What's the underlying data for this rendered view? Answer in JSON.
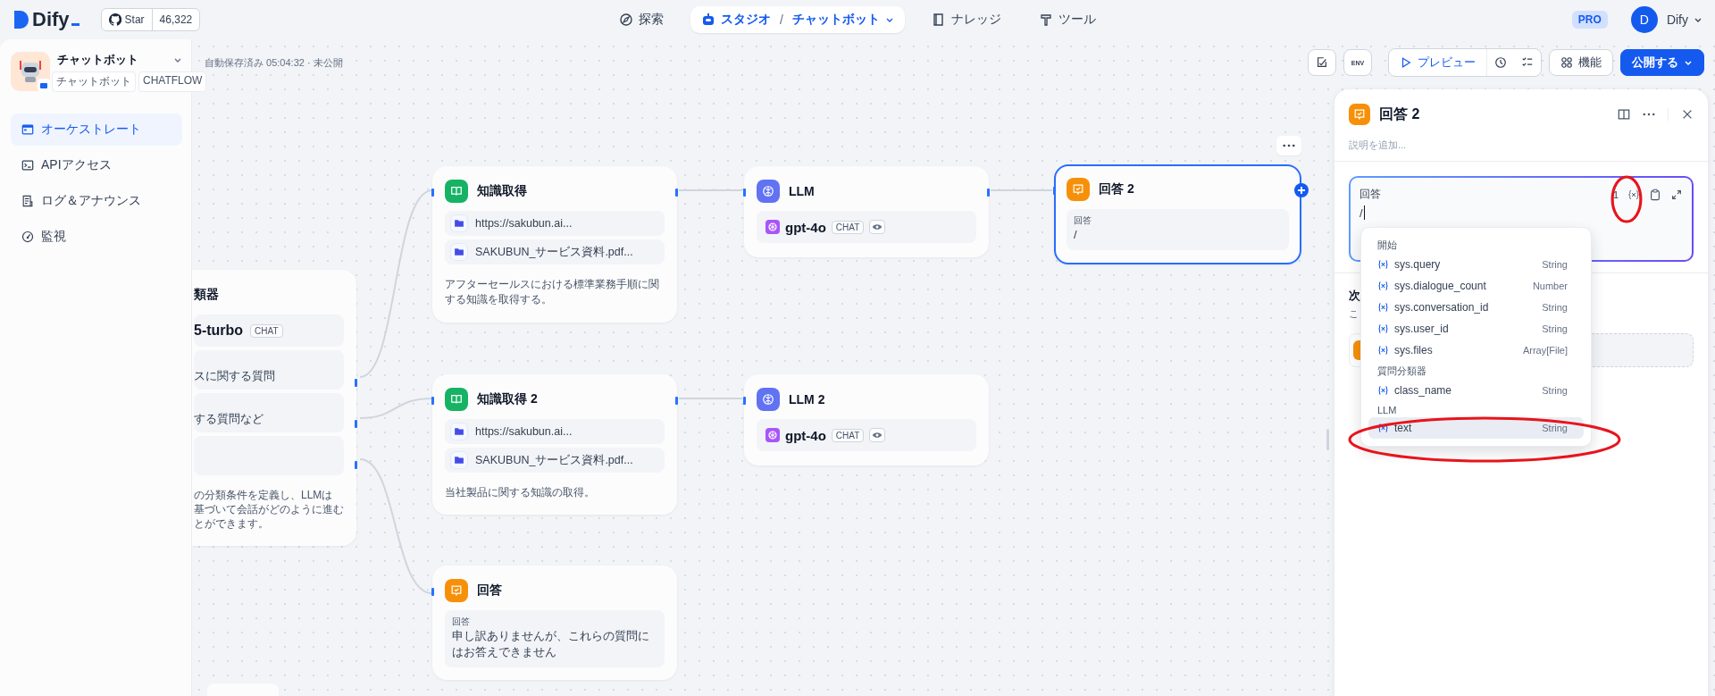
{
  "header": {
    "logo": "Dify",
    "github": {
      "label": "Star",
      "count": "46,322"
    },
    "nav": [
      {
        "label": "探索",
        "selected": false
      },
      {
        "label": "スタジオ",
        "separator": "/",
        "sub": "チャットボット",
        "selected": true
      },
      {
        "label": "ナレッジ",
        "selected": false
      },
      {
        "label": "ツール",
        "selected": false
      }
    ],
    "plan": "PRO",
    "user": {
      "initial": "D",
      "name": "Dify"
    }
  },
  "app": {
    "name": "チャットボット",
    "tags": [
      "チャットボット",
      "CHATFLOW"
    ]
  },
  "sidebar": {
    "items": [
      {
        "label": "オーケストレート",
        "selected": true
      },
      {
        "label": "APIアクセス",
        "selected": false
      },
      {
        "label": "ログ＆アナウンス",
        "selected": false
      },
      {
        "label": "監視",
        "selected": false
      }
    ]
  },
  "toolbar": {
    "autosave": "自動保存済み 05:04:32 · 未公開",
    "env": "ENV",
    "preview": "プレビュー",
    "features": "機能",
    "publish": "公開する"
  },
  "nodes": [
    {
      "kind": "classifier",
      "title": "類器",
      "model": "5-turbo",
      "model_tag": "CHAT",
      "classes": [
        {
          "text": "スに関する質問"
        },
        {
          "text": "する質問など"
        }
      ],
      "description_lines": [
        "の分類条件を定義し、LLMは",
        "基づいて会話がどのように進む",
        "とができます。"
      ],
      "selected": false,
      "has_output": true
    },
    {
      "kind": "knowledge",
      "title": "知識取得",
      "sources": [
        "https://sakubun.ai...",
        "SAKUBUN_サービス資料.pdf..."
      ],
      "description": "アフターセールスにおける標準業務手順に関する知識を取得する。",
      "selected": false,
      "has_output": true
    },
    {
      "kind": "llm",
      "title": "LLM",
      "model": "gpt-4o",
      "model_tag": "CHAT",
      "selected": false,
      "has_output": true
    },
    {
      "kind": "answer",
      "title": "回答 2",
      "field_label": "回答",
      "value": "/",
      "selected": true,
      "has_output": false
    },
    {
      "kind": "knowledge",
      "title": "知識取得 2",
      "sources": [
        "https://sakubun.ai...",
        "SAKUBUN_サービス資料.pdf..."
      ],
      "description": "当社製品に関する知識の取得。",
      "selected": false,
      "has_output": true
    },
    {
      "kind": "llm",
      "title": "LLM 2",
      "model": "gpt-4o",
      "model_tag": "CHAT",
      "selected": false,
      "has_output": false
    },
    {
      "kind": "answer",
      "title": "回答",
      "field_label": "回答",
      "value": "申し訳ありませんが、これらの質問にはお答えできません",
      "selected": false,
      "has_output": false
    }
  ],
  "panel": {
    "title": "回答 2",
    "description_placeholder": "説明を追加...",
    "editor": {
      "label": "回答",
      "count": "1",
      "value": "/"
    },
    "next_step": {
      "title": "次",
      "hint": "こ"
    },
    "variable_menu": {
      "groups": [
        {
          "title": "開始",
          "items": [
            {
              "name": "sys.query",
              "type": "String",
              "selected": false
            },
            {
              "name": "sys.dialogue_count",
              "type": "Number",
              "selected": false
            },
            {
              "name": "sys.conversation_id",
              "type": "String",
              "selected": false
            },
            {
              "name": "sys.user_id",
              "type": "String",
              "selected": false
            },
            {
              "name": "sys.files",
              "type": "Array[File]",
              "selected": false
            }
          ]
        },
        {
          "title": "質問分類器",
          "items": [
            {
              "name": "class_name",
              "type": "String",
              "selected": false
            }
          ]
        },
        {
          "title": "LLM",
          "items": [
            {
              "name": "text",
              "type": "String",
              "selected": true
            }
          ]
        }
      ]
    }
  }
}
